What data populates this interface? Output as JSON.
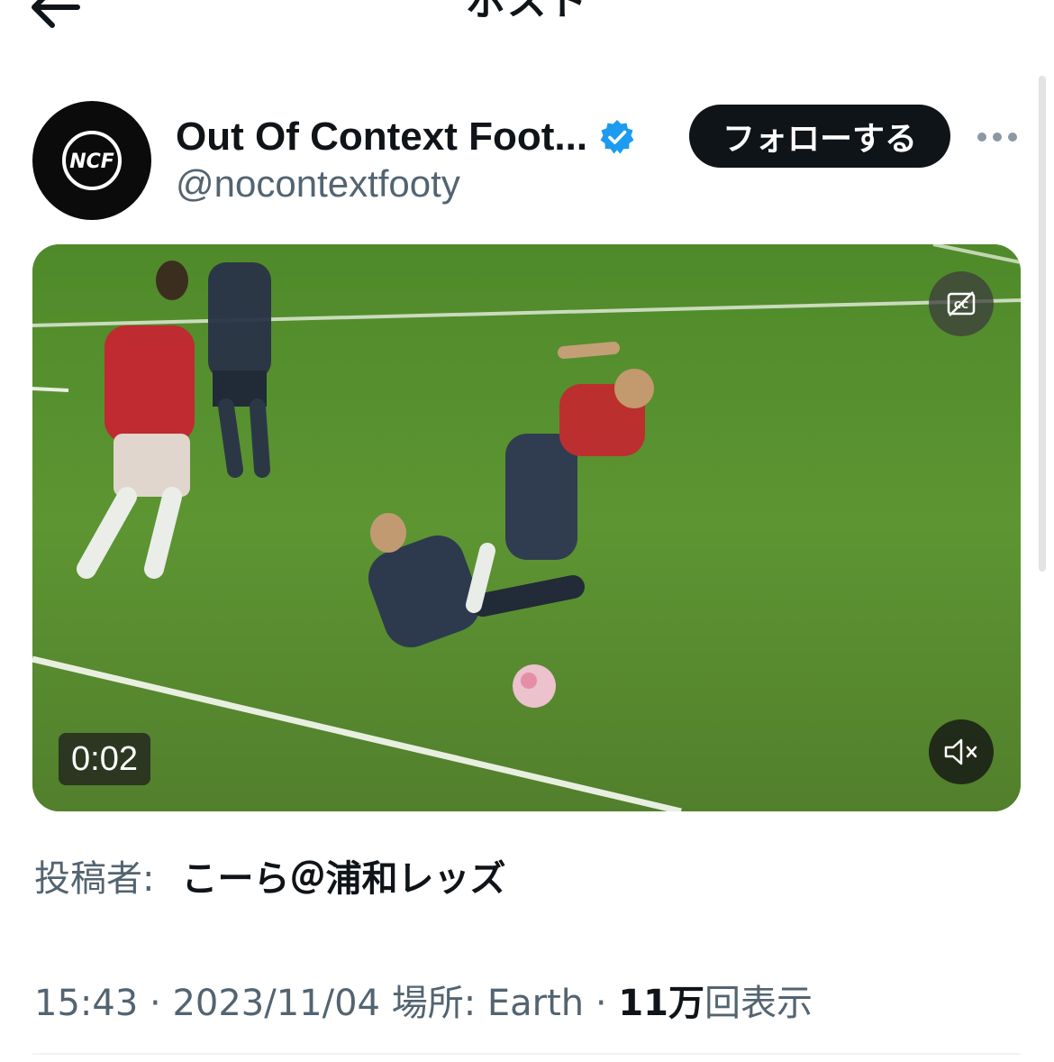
{
  "header": {
    "title": "ポスト"
  },
  "author": {
    "avatar_text": "NCF",
    "display_name": "Out Of Context Foot...",
    "handle": "@nocontextfooty",
    "verified": true,
    "follow_label": "フォローする"
  },
  "video": {
    "duration": "0:02",
    "captions_icon": "captions-off-icon",
    "sound_icon": "mute-icon"
  },
  "post": {
    "poster_label": "投稿者:",
    "poster_name": "こーら＠浦和レッズ"
  },
  "meta": {
    "time": "15:43",
    "sep1": " · ",
    "date": "2023/11/04",
    "location_label": " 場所: ",
    "location": "Earth",
    "sep2": " · ",
    "views_count": "11万",
    "views_label": "回表示"
  },
  "colors": {
    "text": "#0f1419",
    "secondary": "#536471",
    "verified": "#1d9bf0"
  }
}
